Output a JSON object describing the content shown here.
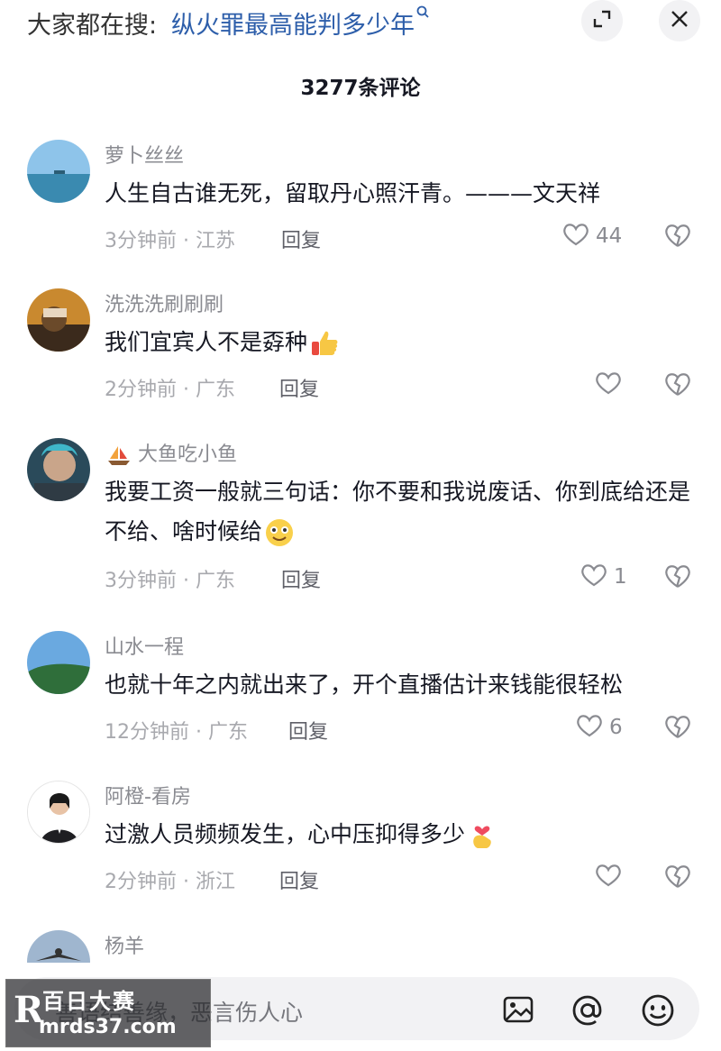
{
  "header": {
    "search_prefix": "大家都在搜:",
    "search_hot_query": "纵火罪最高能判多少年",
    "comment_count": "3277条评论"
  },
  "comments": [
    {
      "username": "萝卜丝丝",
      "text": "人生自古谁无死，留取丹心照汗青。———文天祥",
      "meta": "3分钟前 · 江苏",
      "reply": "回复",
      "likes": "44"
    },
    {
      "username": "洗洗洗刷刷刷",
      "text": "我们宜宾人不是孬种",
      "meta": "2分钟前 · 广东",
      "reply": "回复",
      "likes": ""
    },
    {
      "username": "大鱼吃小鱼",
      "text": "我要工资一般就三句话：你不要和我说废话、你到底给还是不给、啥时候给",
      "meta": "3分钟前 · 广东",
      "reply": "回复",
      "likes": "1"
    },
    {
      "username": "山水一程",
      "text": "也就十年之内就出来了，开个直播估计来钱能很轻松",
      "meta": "12分钟前 · 广东",
      "reply": "回复",
      "likes": "6"
    },
    {
      "username": "阿橙-看房",
      "text": "过激人员频频发生，心中压抑得多少",
      "meta": "2分钟前 · 浙江",
      "reply": "回复",
      "likes": ""
    },
    {
      "username": "杨羊"
    }
  ],
  "input": {
    "placeholder": "善语结善缘，恶言伤人心"
  },
  "watermark": {
    "line1": "百日大赛",
    "line2": "mrds37.com"
  },
  "colors": {
    "hot_query": "#2d5eaa",
    "input_bg": "#f2f2f4"
  }
}
